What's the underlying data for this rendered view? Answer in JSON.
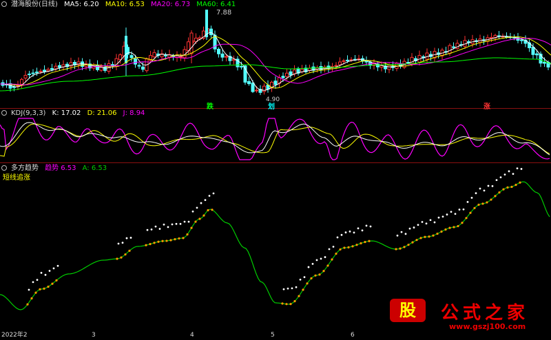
{
  "main_panel": {
    "title": "潜海股份(日线)",
    "ma5": "MA5: 6.20",
    "ma10": "MA10: 6.53",
    "ma20": "MA20: 6.73",
    "ma60": "MA60: 6.41",
    "high_label": "7.88",
    "low_label": "4.90",
    "signals": [
      "跌",
      "划",
      "涨"
    ]
  },
  "kdj_panel": {
    "title": "KDJ(9,3,3)",
    "k": "K: 17.02",
    "d": "D: 21.06",
    "j": "J: 8.94"
  },
  "trend_panel": {
    "title": "多方趋势",
    "trend_label": "趋势",
    "trend_value": "6.53",
    "a": "A: 6.53",
    "subtitle": "短线追涨"
  },
  "axis": {
    "labels": [
      "2022年2",
      "3",
      "4",
      "5",
      "6"
    ]
  },
  "watermark": {
    "badge": "股",
    "title": "公式之家",
    "url": "www.gszj100.com"
  },
  "colors": {
    "bg": "#000000",
    "ma5": "#ffffff",
    "ma10": "#ffff00",
    "ma20": "#ff00ff",
    "ma60": "#00ff00",
    "up": "#ff3232",
    "down": "#54ffff",
    "k": "#ffffff",
    "d": "#ffff00",
    "j": "#ff00ff",
    "trend": "#ff9900",
    "trend_line": "#00cc00"
  },
  "chart_data": [
    {
      "type": "candlestick",
      "title": "潜海股份(日线)",
      "series": [
        {
          "name": "MA5",
          "value": 6.2
        },
        {
          "name": "MA10",
          "value": 6.53
        },
        {
          "name": "MA20",
          "value": 6.73
        },
        {
          "name": "MA60",
          "value": 6.41
        }
      ],
      "annotations": [
        {
          "label": "7.88",
          "kind": "high"
        },
        {
          "label": "4.90",
          "kind": "low"
        }
      ]
    },
    {
      "type": "line",
      "title": "KDJ(9,3,3)",
      "series": [
        {
          "name": "K",
          "value": 17.02
        },
        {
          "name": "D",
          "value": 21.06
        },
        {
          "name": "J",
          "value": 8.94
        }
      ]
    },
    {
      "type": "line",
      "title": "多方趋势",
      "series": [
        {
          "name": "趋势",
          "value": 6.53
        },
        {
          "name": "A",
          "value": 6.53
        }
      ]
    }
  ]
}
